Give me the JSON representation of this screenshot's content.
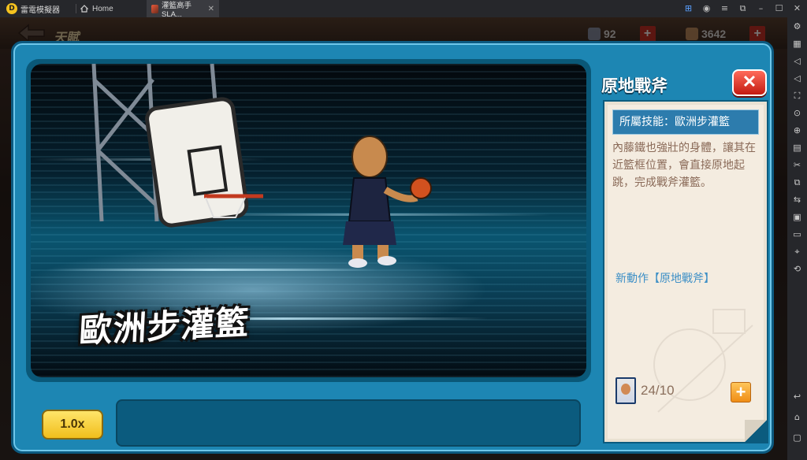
{
  "emulator": {
    "app_name": "雷電模擬器",
    "tabs": [
      {
        "label": "Home"
      },
      {
        "label": "灌籃高手 SLA..."
      }
    ]
  },
  "game_bg": {
    "title": "天賦",
    "resource_1": "92",
    "resource_2": "3642"
  },
  "modal": {
    "title": "原地戰斧",
    "close_label": "✕",
    "move_caption": "歐洲步灌籃",
    "speed_label": "1.0x",
    "subtitle_text": "",
    "skill_header": "所屬技能：歐洲步灌籃",
    "description": "內藤鐵也強壯的身體，讓其在近籃框位置，會直接原地起跳，完成戰斧灌籃。",
    "new_move": "新動作【原地戰斧】",
    "card_count": "24/10",
    "add_label": "+"
  },
  "colors": {
    "modal_blue": "#1d86b3",
    "close_red": "#d8281c",
    "speed_yellow": "#f6cc2b",
    "plus_orange": "#f39a1e",
    "skill_header_blue": "#2d7cad"
  }
}
